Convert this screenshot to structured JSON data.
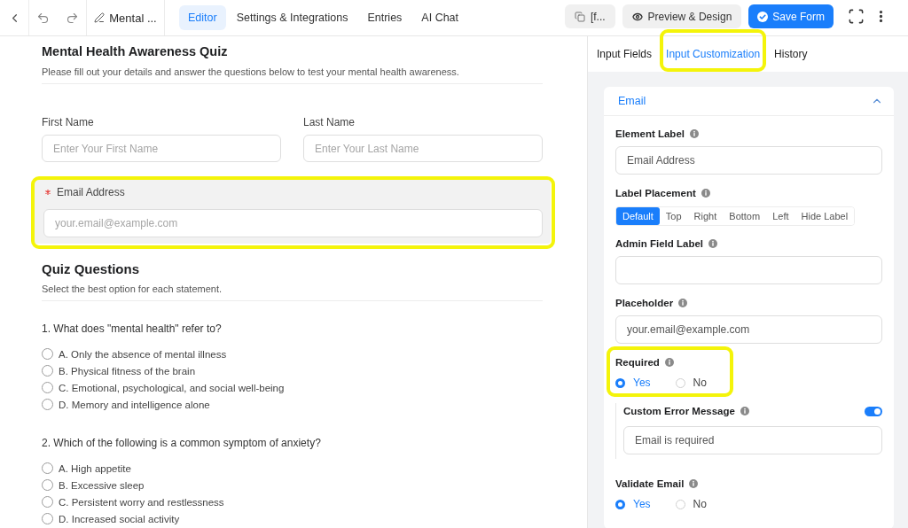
{
  "top_bar": {
    "form_name": "Mental ...",
    "tabs": [
      {
        "label": "Editor",
        "selected": true
      },
      {
        "label": "Settings & Integrations",
        "selected": false
      },
      {
        "label": "Entries",
        "selected": false
      },
      {
        "label": "AI Chat",
        "selected": false
      }
    ],
    "shortcode_button": "[f...",
    "preview_button": "Preview & Design",
    "save_button": "Save Form"
  },
  "form": {
    "title": "Mental Health Awareness Quiz",
    "description": "Please fill out your details and answer the questions below to test your mental health awareness.",
    "name_fields": [
      {
        "label": "First Name",
        "placeholder": "Enter Your First Name"
      },
      {
        "label": "Last Name",
        "placeholder": "Enter Your Last Name"
      }
    ],
    "email_field": {
      "label": "Email Address",
      "placeholder": "your.email@example.com",
      "required": true,
      "selected": true,
      "highlighted": true
    }
  },
  "quiz": {
    "title": "Quiz Questions",
    "description": "Select the best option for each statement.",
    "questions": [
      {
        "text": "1. What does \"mental health\" refer to?",
        "options": [
          {
            "label": "A. Only the absence of mental illness",
            "selected": false
          },
          {
            "label": "B. Physical fitness of the brain",
            "selected": false
          },
          {
            "label": "C. Emotional, psychological, and social well-being",
            "selected": false
          },
          {
            "label": "D. Memory and intelligence alone",
            "selected": false
          }
        ]
      },
      {
        "text": "2. Which of the following is a common symptom of anxiety?",
        "options": [
          {
            "label": "A. High appetite",
            "selected": false
          },
          {
            "label": "B. Excessive sleep",
            "selected": false
          },
          {
            "label": "C. Persistent worry and restlessness",
            "selected": false
          },
          {
            "label": "D. Increased social activity",
            "selected": false
          }
        ]
      }
    ]
  },
  "settings_panel": {
    "tabs": [
      {
        "label": "Input Fields",
        "selected": false,
        "highlighted": false
      },
      {
        "label": "Input Customization",
        "selected": true,
        "highlighted": true
      },
      {
        "label": "History",
        "selected": false,
        "highlighted": false
      }
    ],
    "section": {
      "title": "Email",
      "expanded": true
    },
    "settings": [
      {
        "kind": "text",
        "label": "Element Label",
        "value": "Email Address"
      },
      {
        "kind": "segmented",
        "label": "Label Placement",
        "options": [
          {
            "label": "Default",
            "selected": true
          },
          {
            "label": "Top",
            "selected": false
          },
          {
            "label": "Right",
            "selected": false
          },
          {
            "label": "Bottom",
            "selected": false
          },
          {
            "label": "Left",
            "selected": false
          },
          {
            "label": "Hide Label",
            "selected": false
          }
        ]
      },
      {
        "kind": "text",
        "label": "Admin Field Label"
      },
      {
        "kind": "text",
        "label": "Placeholder",
        "value": "your.email@example.com"
      },
      {
        "kind": "radio",
        "label": "Required",
        "highlighted": true,
        "options": [
          {
            "label": "Yes",
            "selected": true
          },
          {
            "label": "No",
            "selected": false
          }
        ],
        "error_message": {
          "label": "Custom Error Message",
          "on": true,
          "value": "Email is required"
        }
      },
      {
        "kind": "radio",
        "label": "Validate Email",
        "options": [
          {
            "label": "Yes",
            "selected": true
          },
          {
            "label": "No",
            "selected": false
          }
        ]
      }
    ]
  }
}
